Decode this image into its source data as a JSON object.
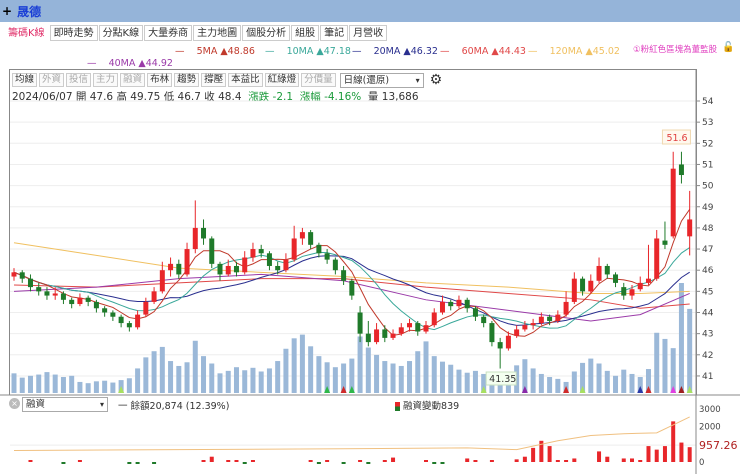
{
  "title": {
    "plus": "+",
    "stock": "晟德"
  },
  "tabs": [
    {
      "label": "籌碼K線",
      "active": true
    },
    {
      "label": "即時走勢"
    },
    {
      "label": "分點K線"
    },
    {
      "label": "大量券商"
    },
    {
      "label": "主力地圖"
    },
    {
      "label": "個股分析"
    },
    {
      "label": "組股"
    },
    {
      "label": "筆記"
    },
    {
      "label": "月營收"
    }
  ],
  "ma_legend": [
    {
      "name": "5MA",
      "value": "▲48.86",
      "color": "#c0392b"
    },
    {
      "name": "10MA",
      "value": "▲47.18",
      "color": "#3aa89a"
    },
    {
      "name": "20MA",
      "value": "▲46.32",
      "color": "#2a2f8f"
    },
    {
      "name": "60MA",
      "value": "▲44.43",
      "color": "#e04848"
    },
    {
      "name": "120MA",
      "value": "▲45.02",
      "color": "#f0c060"
    },
    {
      "name": "40MA",
      "value": "▲44.92",
      "color": "#9a3aa8"
    }
  ],
  "hint": "①粉紅色區塊為董監股",
  "toolbar": {
    "buttons": [
      {
        "label": "均線"
      },
      {
        "label": "外資",
        "disabled": true
      },
      {
        "label": "投信",
        "disabled": true
      },
      {
        "label": "主力",
        "disabled": true
      },
      {
        "label": "融資",
        "disabled": true
      },
      {
        "label": "布林"
      },
      {
        "label": "趨勢"
      },
      {
        "label": "撐壓"
      },
      {
        "label": "本益比"
      },
      {
        "label": "紅綠燈"
      },
      {
        "label": "分價量",
        "disabled": true
      }
    ],
    "period_select": "日線(還原)"
  },
  "info": {
    "date": "2024/06/07",
    "open_label": "開",
    "open": "47.6",
    "high_label": "高",
    "high": "49.75",
    "low_label": "低",
    "low": "46.7",
    "close_label": "收",
    "close": "48.4",
    "chg_label": "漲跌",
    "chg": "-2.1",
    "pct_label": "漲幅",
    "pct": "-4.16%",
    "vol_label": "量",
    "vol": "13,686"
  },
  "colors": {
    "up": "#e8262a",
    "down": "#1f7a2a",
    "volume": "#9bb8d8",
    "balance": "#f0c080"
  },
  "chart_data": {
    "type": "candlestick",
    "y_ticks": [
      41,
      42,
      43,
      44,
      45,
      46,
      47,
      48,
      49,
      50,
      51,
      52,
      53,
      54
    ],
    "ylim": [
      40.2,
      54.2
    ],
    "high_label": "51.6",
    "low_label": "41.35",
    "ohlc": [
      [
        45.7,
        46.1,
        45.5,
        45.9
      ],
      [
        45.9,
        46.0,
        45.4,
        45.6
      ],
      [
        45.6,
        45.8,
        45.0,
        45.2
      ],
      [
        45.2,
        45.4,
        44.8,
        45.0
      ],
      [
        45.0,
        45.2,
        44.6,
        44.8
      ],
      [
        44.8,
        45.2,
        44.6,
        44.9
      ],
      [
        44.9,
        45.0,
        44.4,
        44.6
      ],
      [
        44.6,
        44.7,
        44.2,
        44.4
      ],
      [
        44.4,
        44.9,
        44.3,
        44.7
      ],
      [
        44.7,
        44.8,
        44.3,
        44.5
      ],
      [
        44.5,
        44.6,
        44.0,
        44.2
      ],
      [
        44.2,
        44.3,
        43.8,
        44.0
      ],
      [
        44.0,
        44.1,
        43.6,
        43.8
      ],
      [
        43.8,
        43.9,
        43.3,
        43.5
      ],
      [
        43.5,
        43.6,
        43.1,
        43.3
      ],
      [
        43.3,
        44.1,
        43.2,
        43.9
      ],
      [
        43.9,
        44.7,
        43.8,
        44.5
      ],
      [
        44.5,
        45.2,
        44.4,
        45.0
      ],
      [
        45.0,
        46.4,
        44.9,
        46.0
      ],
      [
        46.0,
        46.6,
        45.7,
        46.3
      ],
      [
        46.3,
        46.5,
        45.6,
        45.8
      ],
      [
        45.8,
        47.3,
        45.7,
        47.0
      ],
      [
        47.0,
        49.3,
        46.8,
        48.0
      ],
      [
        48.0,
        48.4,
        47.2,
        47.5
      ],
      [
        47.5,
        47.6,
        46.1,
        46.3
      ],
      [
        46.3,
        46.4,
        45.5,
        45.8
      ],
      [
        45.8,
        46.5,
        45.7,
        46.2
      ],
      [
        46.2,
        46.4,
        45.7,
        45.9
      ],
      [
        45.9,
        46.9,
        45.8,
        46.6
      ],
      [
        46.6,
        47.3,
        46.4,
        47.0
      ],
      [
        47.0,
        47.2,
        46.6,
        46.8
      ],
      [
        46.8,
        46.9,
        46.0,
        46.2
      ],
      [
        46.2,
        46.4,
        45.8,
        46.0
      ],
      [
        46.0,
        46.8,
        45.9,
        46.5
      ],
      [
        46.5,
        48.1,
        46.4,
        47.5
      ],
      [
        47.5,
        48.0,
        47.2,
        47.8
      ],
      [
        47.8,
        47.9,
        47.0,
        47.2
      ],
      [
        47.2,
        47.3,
        46.6,
        46.8
      ],
      [
        46.8,
        47.0,
        46.3,
        46.5
      ],
      [
        46.5,
        46.6,
        45.8,
        46.0
      ],
      [
        46.0,
        46.2,
        45.3,
        45.5
      ],
      [
        45.5,
        45.6,
        44.6,
        44.8
      ],
      [
        44.0,
        44.3,
        42.6,
        43.0
      ],
      [
        43.0,
        43.6,
        42.4,
        42.6
      ],
      [
        42.6,
        43.5,
        42.5,
        43.2
      ],
      [
        43.2,
        43.4,
        42.6,
        42.8
      ],
      [
        42.8,
        43.2,
        42.7,
        43.0
      ],
      [
        43.0,
        43.5,
        42.9,
        43.3
      ],
      [
        43.3,
        43.7,
        43.1,
        43.5
      ],
      [
        43.5,
        43.6,
        42.9,
        43.1
      ],
      [
        43.1,
        43.6,
        43.0,
        43.4
      ],
      [
        43.4,
        44.2,
        43.3,
        44.0
      ],
      [
        44.0,
        44.8,
        43.9,
        44.5
      ],
      [
        44.5,
        44.6,
        44.1,
        44.3
      ],
      [
        44.3,
        44.8,
        44.2,
        44.6
      ],
      [
        44.6,
        44.7,
        44.0,
        44.2
      ],
      [
        44.2,
        44.3,
        43.6,
        43.8
      ],
      [
        43.8,
        43.9,
        43.3,
        43.5
      ],
      [
        43.5,
        43.6,
        42.4,
        42.6
      ],
      [
        42.6,
        42.8,
        41.35,
        42.3
      ],
      [
        42.3,
        43.1,
        42.2,
        42.9
      ],
      [
        42.9,
        43.4,
        42.8,
        43.2
      ],
      [
        43.2,
        43.6,
        43.1,
        43.4
      ],
      [
        43.4,
        43.7,
        43.2,
        43.5
      ],
      [
        43.5,
        44.0,
        43.4,
        43.8
      ],
      [
        43.8,
        43.9,
        43.4,
        43.6
      ],
      [
        43.6,
        44.1,
        43.5,
        43.9
      ],
      [
        43.9,
        45.0,
        43.8,
        44.5
      ],
      [
        44.5,
        45.9,
        44.4,
        45.6
      ],
      [
        45.6,
        45.7,
        44.8,
        45.0
      ],
      [
        45.0,
        45.8,
        44.9,
        45.5
      ],
      [
        45.5,
        46.6,
        45.4,
        46.2
      ],
      [
        46.2,
        46.3,
        45.6,
        45.8
      ],
      [
        45.8,
        45.9,
        45.2,
        45.4
      ],
      [
        45.2,
        45.4,
        44.6,
        44.8
      ],
      [
        44.8,
        45.3,
        44.6,
        45.1
      ],
      [
        45.1,
        45.7,
        45.0,
        45.4
      ],
      [
        45.4,
        47.2,
        45.3,
        45.6
      ],
      [
        45.6,
        47.9,
        45.5,
        47.5
      ],
      [
        47.4,
        48.3,
        47.0,
        47.2
      ],
      [
        47.6,
        51.6,
        47.5,
        50.8
      ],
      [
        51.0,
        51.6,
        50.1,
        50.5
      ],
      [
        47.6,
        49.75,
        46.7,
        48.4
      ]
    ],
    "volume": [
      3200,
      2500,
      2800,
      3000,
      3400,
      3000,
      2600,
      2800,
      1800,
      1600,
      1900,
      2000,
      1700,
      2100,
      2400,
      4000,
      5800,
      6800,
      7500,
      5200,
      4400,
      5000,
      8500,
      6000,
      4800,
      3200,
      3600,
      4200,
      3700,
      4100,
      3500,
      4000,
      5200,
      7200,
      8900,
      9500,
      7600,
      6000,
      5000,
      4200,
      4800,
      5600,
      9200,
      7400,
      6200,
      5200,
      4800,
      4400,
      5200,
      6800,
      8400,
      6000,
      5100,
      4600,
      3800,
      3300,
      3600,
      3100,
      2700,
      2300,
      3100,
      4500,
      5500,
      4000,
      3100,
      2600,
      2300,
      1800,
      3500,
      4900,
      5600,
      4800,
      3600,
      2800,
      3800,
      3100,
      2600,
      3900,
      9800,
      8800,
      7300,
      17900,
      13686
    ],
    "markers": [
      {
        "i": 13,
        "color": "#a8e060"
      },
      {
        "i": 38,
        "color": "#2fb84a"
      },
      {
        "i": 40,
        "color": "#d02a2a"
      },
      {
        "i": 41,
        "color": "#2fb84a"
      },
      {
        "i": 57,
        "color": "#a8e060"
      },
      {
        "i": 62,
        "color": "#8a2aa8"
      },
      {
        "i": 67,
        "color": "#d02a2a"
      },
      {
        "i": 69,
        "color": "#a8e060"
      },
      {
        "i": 76,
        "color": "#2a3aa8"
      },
      {
        "i": 77,
        "color": "#d02a2a"
      },
      {
        "i": 80,
        "color": "#e040e0"
      },
      {
        "i": 81,
        "color": "#a02020"
      },
      {
        "i": 82,
        "color": "#a8e060"
      }
    ],
    "ma_lines": {
      "ma40": {
        "i": [
          0,
          10,
          20,
          30,
          40,
          50,
          60,
          70,
          76,
          82
        ],
        "v": [
          45.0,
          45.2,
          45.6,
          45.8,
          45.5,
          44.6,
          44.1,
          43.6,
          43.9,
          44.9
        ]
      },
      "ma60": {
        "i": [
          0,
          10,
          20,
          30,
          40,
          50,
          60,
          70,
          76,
          82
        ],
        "v": [
          45.3,
          45.2,
          45.4,
          45.6,
          45.6,
          45.2,
          44.9,
          44.6,
          44.2,
          44.4
        ]
      },
      "ma120": {
        "i": [
          0,
          10,
          20,
          30,
          40,
          50,
          60,
          70,
          76,
          82
        ],
        "v": [
          47.3,
          46.7,
          46.1,
          45.9,
          45.7,
          45.4,
          45.2,
          44.9,
          44.9,
          45.0
        ]
      }
    },
    "margin": {
      "select": "融資",
      "balance_label": "一 餘額20,874 (12.39%)",
      "change_label": "融資變動839",
      "value_label": "957.26",
      "y_ticks": [
        0,
        1000,
        2000,
        3000
      ],
      "ylim": [
        -200,
        3200
      ],
      "change": [
        0,
        0,
        30,
        0,
        0,
        0,
        -20,
        0,
        10,
        0,
        0,
        0,
        0,
        0,
        -20,
        -40,
        0,
        -30,
        0,
        0,
        0,
        0,
        0,
        20,
        300,
        0,
        80,
        90,
        -20,
        60,
        0,
        0,
        0,
        0,
        0,
        0,
        40,
        -60,
        60,
        0,
        -40,
        0,
        50,
        -50,
        0,
        80,
        250,
        0,
        0,
        0,
        60,
        -50,
        -40,
        0,
        0,
        200,
        90,
        0,
        50,
        0,
        0,
        0,
        0,
        -20,
        0,
        0,
        -60,
        0,
        -80,
        0,
        0,
        -40,
        0,
        -30,
        0,
        -40,
        0,
        -60,
        0,
        0,
        0,
        0,
        0
      ],
      "change_tail": [
        150,
        300,
        800,
        1200,
        900,
        100,
        50,
        200,
        0,
        0,
        600,
        300,
        0,
        200,
        200,
        100,
        900,
        700,
        900,
        2300,
        1100,
        839
      ],
      "balance": {
        "i": [
          0,
          20,
          40,
          55,
          61,
          66,
          70,
          74,
          78,
          80,
          82
        ],
        "v": [
          650,
          700,
          750,
          800,
          700,
          1200,
          1500,
          1600,
          1650,
          2100,
          2550
        ]
      }
    }
  }
}
